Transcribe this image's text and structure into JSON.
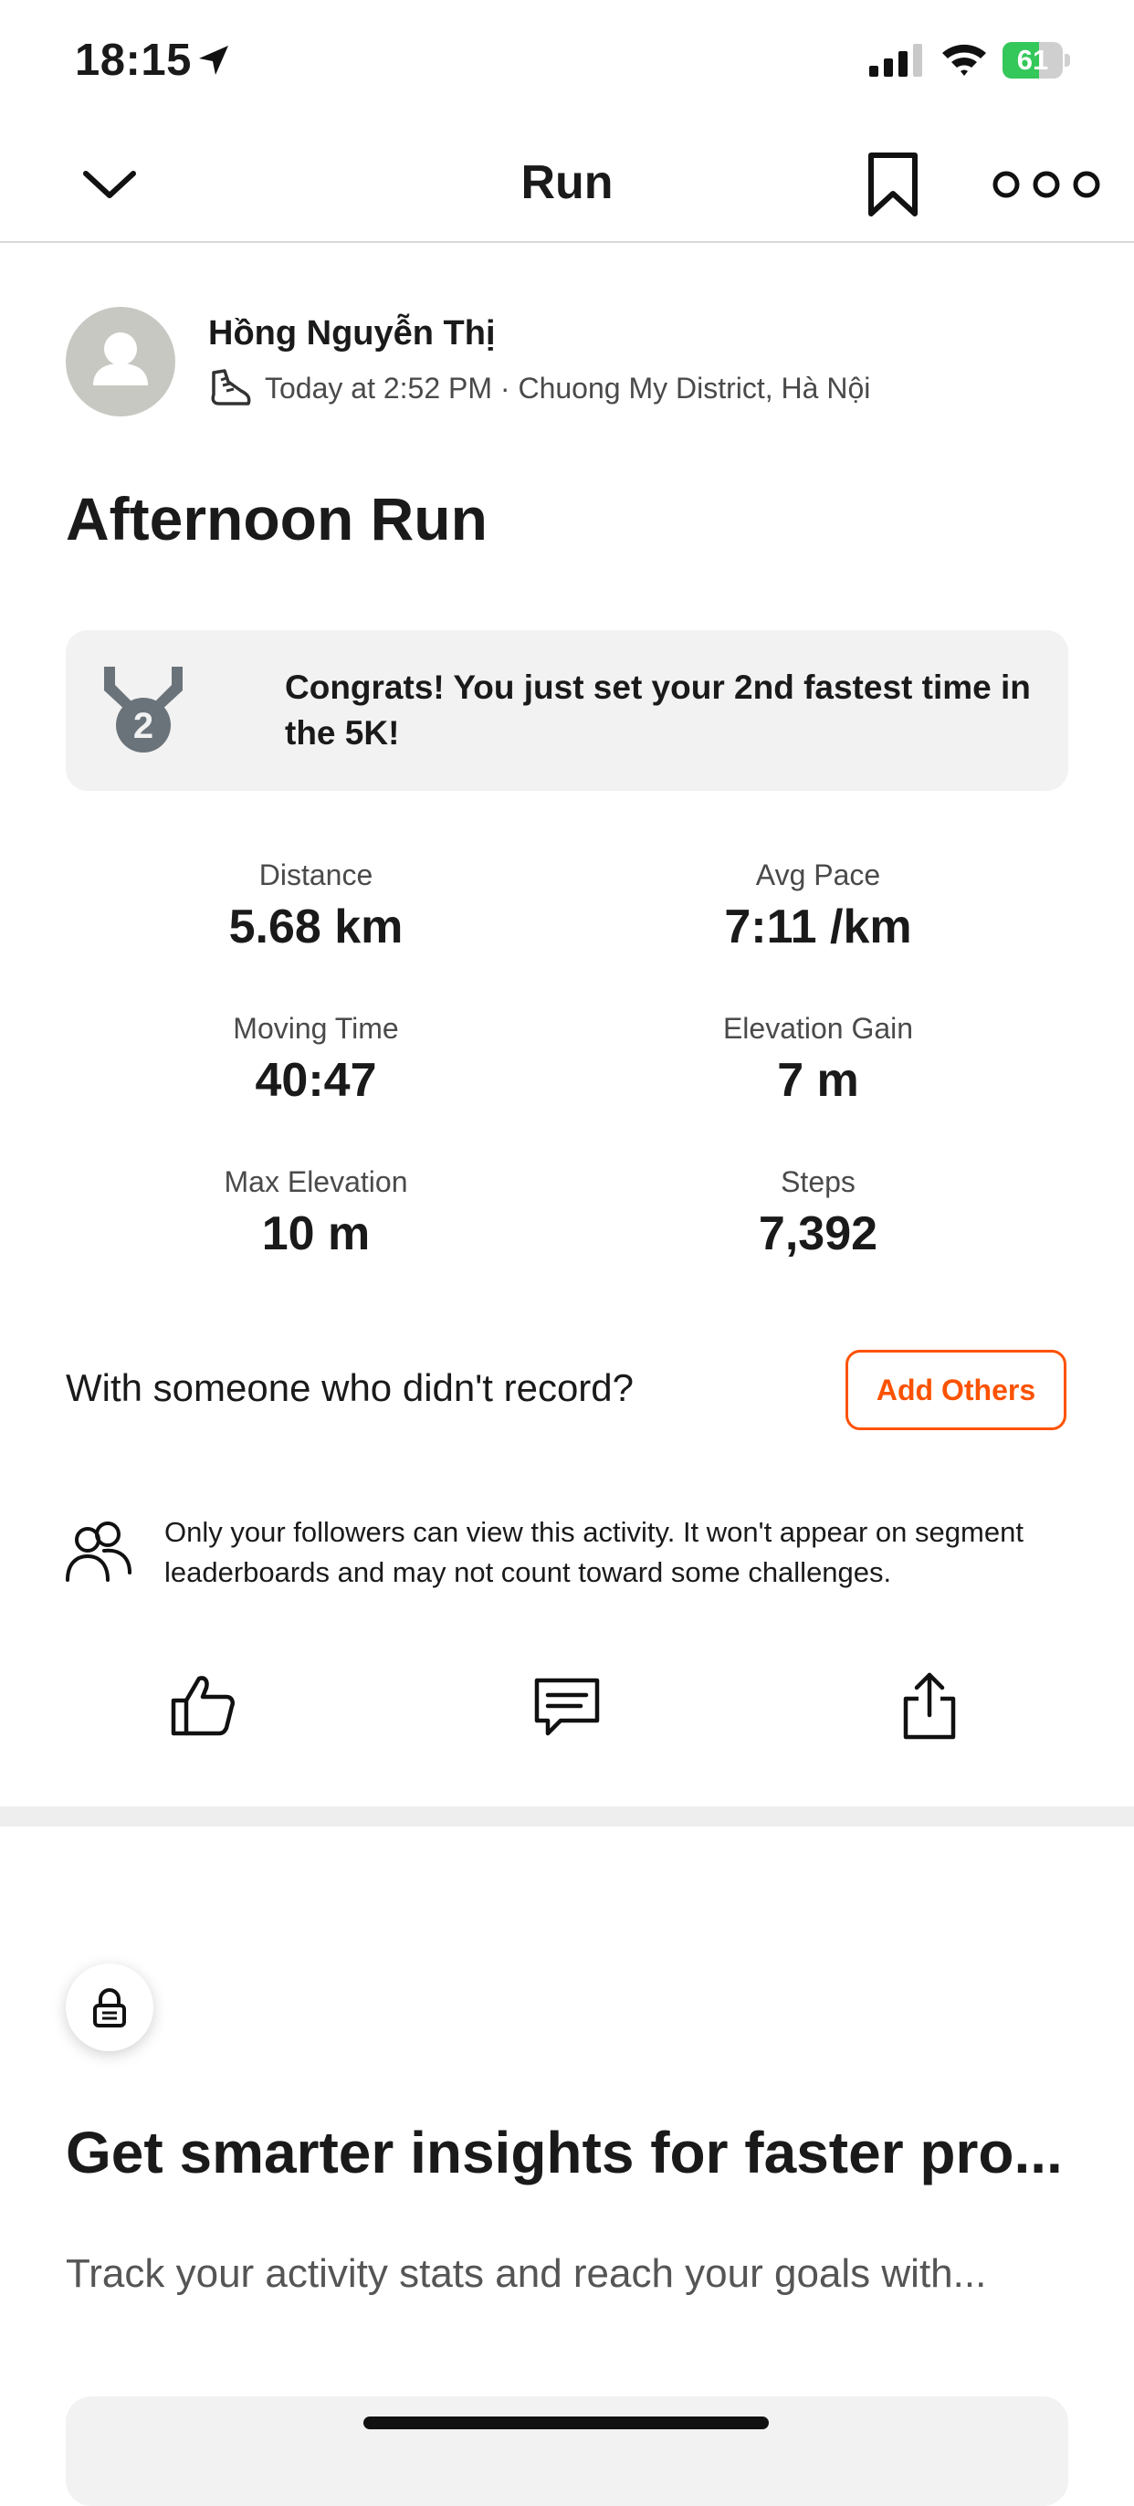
{
  "status_bar": {
    "time": "18:15",
    "battery": "61",
    "battery_level": 0.61,
    "accent_battery": "#34c759"
  },
  "nav": {
    "title": "Run",
    "back_icon": "chevron-down-icon",
    "bookmark_icon": "bookmark-icon",
    "more_icon": "more-icon"
  },
  "author": {
    "name": "Hồng Nguyễn Thị",
    "meta": "Today at 2:52 PM · Chuong My District, Hà Nội",
    "activity_icon": "shoe-icon"
  },
  "activity": {
    "title": "Afternoon Run"
  },
  "achievement": {
    "text": "Congrats! You just set your 2nd fastest time in the 5K!",
    "medal_rank": "2"
  },
  "stats": [
    {
      "label": "Distance",
      "value": "5.68 km"
    },
    {
      "label": "Avg Pace",
      "value": "7:11 /km"
    },
    {
      "label": "Moving Time",
      "value": "40:47"
    },
    {
      "label": "Elevation Gain",
      "value": "7 m"
    },
    {
      "label": "Max Elevation",
      "value": "10 m"
    },
    {
      "label": "Steps",
      "value": "7,392"
    }
  ],
  "group": {
    "prompt": "With someone who didn't record?",
    "button_label": "Add Others"
  },
  "privacy": {
    "text": "Only your followers can view this activity. It won't appear on segment leaderboards and may not count toward some challenges."
  },
  "actions": {
    "like_icon": "thumbs-up-icon",
    "comment_icon": "comment-icon",
    "share_icon": "share-icon"
  },
  "promo": {
    "title": "Get smarter insights for faster pro...",
    "subtitle": "Track your activity stats and reach your goals with..."
  },
  "colors": {
    "brand": "#fc5200",
    "text": "#1a1a1a",
    "muted": "#4a4a4a"
  }
}
